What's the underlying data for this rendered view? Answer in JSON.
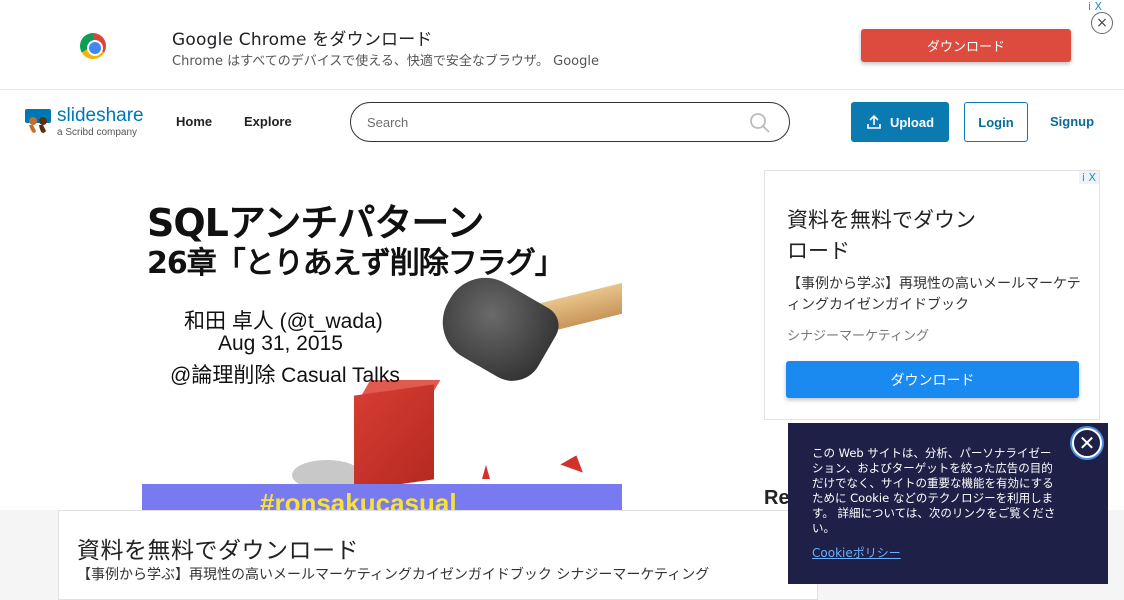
{
  "top_ad": {
    "title": "Google Chrome をダウンロード",
    "subtitle": "Chrome はすべてのデバイスで使える、快適で安全なブラウザ。 Google",
    "button": "ダウンロード",
    "ad_choices": "i X",
    "close": "×",
    "icon": "chrome-logo-icon"
  },
  "nav": {
    "logo_text": "slideshare",
    "logo_sub": "a Scribd company",
    "home": "Home",
    "explore": "Explore",
    "search_placeholder": "Search",
    "upload": "Upload",
    "login": "Login",
    "signup": "Signup",
    "brand_color": "#0a7ab1"
  },
  "slide": {
    "title1": "SQLアンチパターン",
    "title2": "26章「とりあえず削除フラグ」",
    "author": "和田 卓人 (@t_wada)",
    "date": "Aug 31, 2015",
    "event": "@論理削除 Casual Talks",
    "hashtag": "#ronsakucasual"
  },
  "side_ad": {
    "ad_choices": "i X",
    "title": "資料を無料でダウンロード",
    "body": "【事例から学ぶ】再現性の高いメールマーケティングカイゼンガイドブック",
    "brand": "シナジーマーケティング",
    "button": "ダウンロード",
    "button_color": "#1a8af0"
  },
  "related_heading": "Re",
  "bottom_ad": {
    "title": "資料を無料でダウンロード",
    "subtitle": "【事例から学ぶ】再現性の高いメールマーケティングカイゼンガイドブック シナジーマーケティング"
  },
  "cookie": {
    "text": "この Web サイトは、分析、パーソナライゼーション、およびターゲットを絞った広告の目的だけでなく、サイトの重要な機能を有効にするために Cookie などのテクノロジーを利用します。 詳細については、次のリンクをご覧ください。",
    "link": "Cookieポリシー",
    "close": "✕"
  }
}
